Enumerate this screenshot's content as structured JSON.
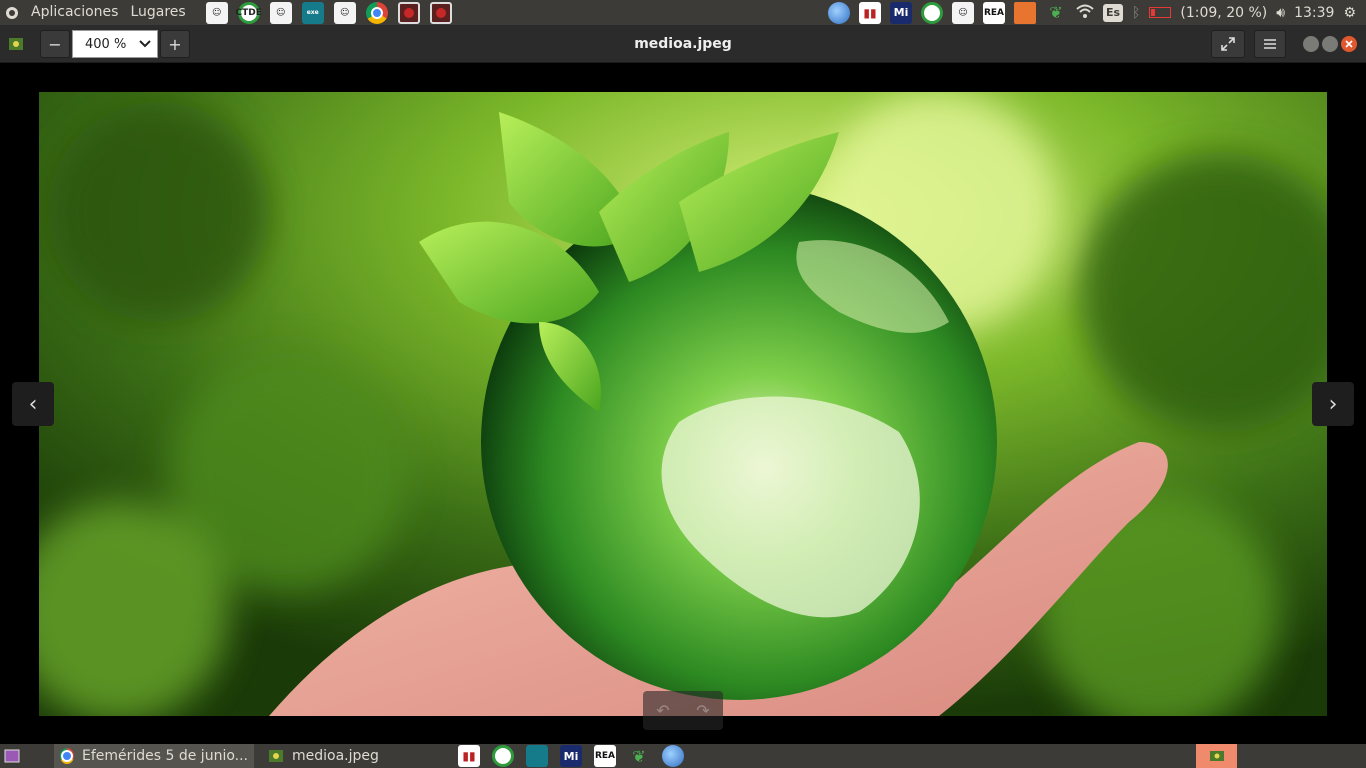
{
  "top_panel": {
    "applications_label": "Aplicaciones",
    "places_label": "Lugares",
    "launchers": [
      {
        "name": "avatar-launcher-icon",
        "label": ""
      },
      {
        "name": "ctde-launcher-icon",
        "label": "CTDE"
      },
      {
        "name": "avatar-launcher-icon",
        "label": ""
      },
      {
        "name": "exelearning-launcher-icon",
        "label": "exe"
      },
      {
        "name": "avatar-launcher-icon",
        "label": ""
      },
      {
        "name": "chrome-icon",
        "label": ""
      },
      {
        "name": "recorder-icon",
        "label": ""
      },
      {
        "name": "recorder-icon",
        "label": ""
      }
    ],
    "tray": {
      "mi_label": "Mi",
      "rea_label": "REA",
      "keyboard_layout": "Es",
      "battery_text": "(1:09, 20 %)",
      "clock": "13:39"
    }
  },
  "viewer": {
    "zoom_value": "400 %",
    "zoom_out_label": "−",
    "zoom_in_label": "+",
    "title": "medioa.jpeg",
    "prev_label": "‹",
    "next_label": "›",
    "rotate_left_label": "↶",
    "rotate_right_label": "↷"
  },
  "taskbar": {
    "tasks": [
      {
        "label": "Efemérides 5 de junio...",
        "active": true
      },
      {
        "label": "medioa.jpeg",
        "active": false
      }
    ],
    "rea_label": "REA",
    "mi_label": "Mi"
  }
}
